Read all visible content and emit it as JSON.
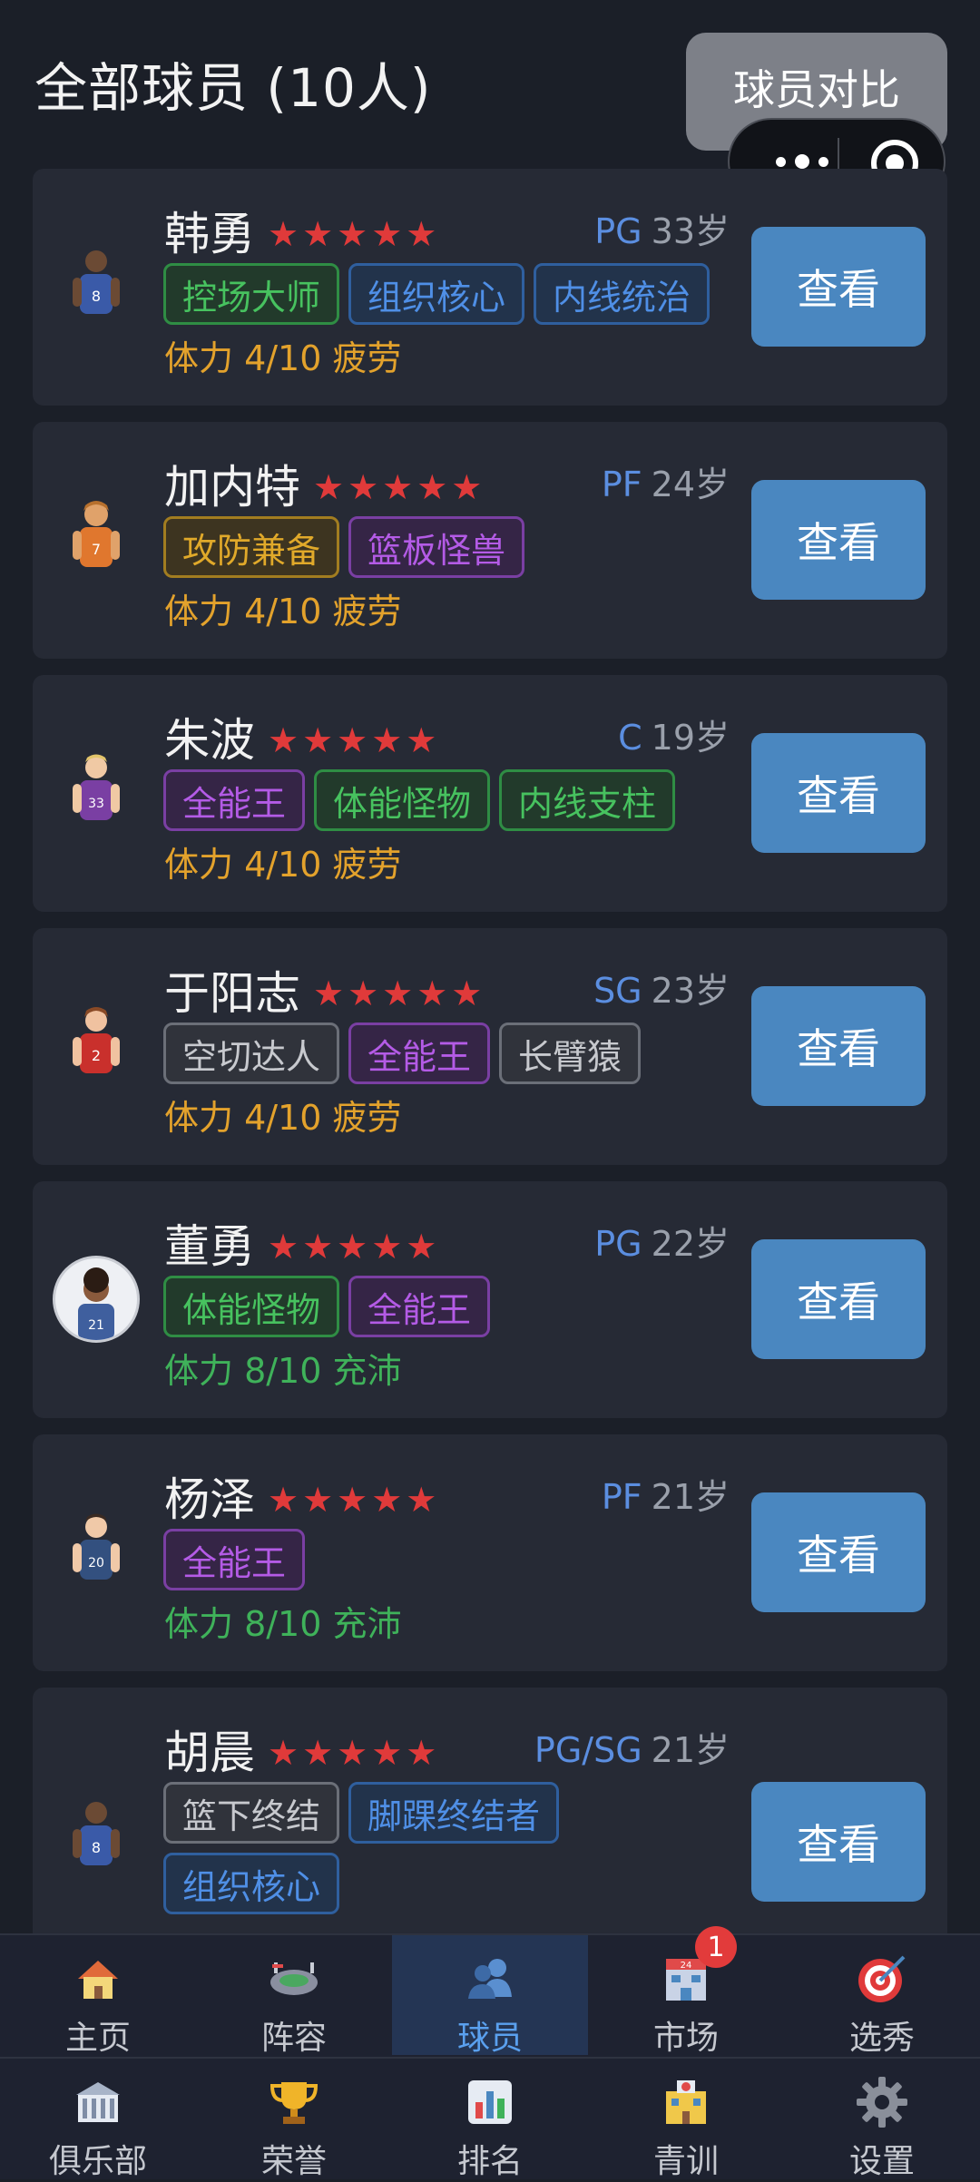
{
  "header": {
    "title": "全部球员 (10人)",
    "compare_label": "球员对比"
  },
  "players": [
    {
      "name": "韩勇",
      "stars": "★★★★★",
      "position": "PG",
      "age": "33岁",
      "tags": [
        {
          "label": "控场大师",
          "color": "green"
        },
        {
          "label": "组织核心",
          "color": "blue"
        },
        {
          "label": "内线统治",
          "color": "blue"
        }
      ],
      "stamina": "体力 4/10 疲劳",
      "view_label": "查看"
    },
    {
      "name": "加内特",
      "stars": "★★★★★",
      "position": "PF",
      "age": "24岁",
      "tags": [
        {
          "label": "攻防兼备",
          "color": "gold"
        },
        {
          "label": "篮板怪兽",
          "color": "purple"
        }
      ],
      "stamina": "体力 4/10 疲劳",
      "view_label": "查看"
    },
    {
      "name": "朱波",
      "stars": "★★★★★",
      "position": "C",
      "age": "19岁",
      "tags": [
        {
          "label": "全能王",
          "color": "purple"
        },
        {
          "label": "体能怪物",
          "color": "green"
        },
        {
          "label": "内线支柱",
          "color": "green"
        }
      ],
      "stamina": "体力 4/10 疲劳",
      "view_label": "查看"
    },
    {
      "name": "于阳志",
      "stars": "★★★★★",
      "position": "SG",
      "age": "23岁",
      "tags": [
        {
          "label": "空切达人",
          "color": "gray"
        },
        {
          "label": "全能王",
          "color": "purple"
        },
        {
          "label": "长臂猿",
          "color": "gray"
        }
      ],
      "stamina": "体力 4/10 疲劳",
      "view_label": "查看"
    },
    {
      "name": "董勇",
      "stars": "★★★★★",
      "position": "PG",
      "age": "22岁",
      "tags": [
        {
          "label": "体能怪物",
          "color": "green"
        },
        {
          "label": "全能王",
          "color": "purple"
        }
      ],
      "stamina": "体力 8/10 充沛",
      "view_label": "查看"
    },
    {
      "name": "杨泽",
      "stars": "★★★★★",
      "position": "PF",
      "age": "21岁",
      "tags": [
        {
          "label": "全能王",
          "color": "purple"
        }
      ],
      "stamina": "体力 8/10 充沛",
      "view_label": "查看"
    },
    {
      "name": "胡晨",
      "stars": "★★★★★",
      "position": "PG/SG",
      "age": "21岁",
      "tags": [
        {
          "label": "篮下终结",
          "color": "gray"
        },
        {
          "label": "脚踝终结者",
          "color": "blue"
        },
        {
          "label": "组织核心",
          "color": "blue"
        }
      ],
      "stamina": "",
      "view_label": "查看"
    }
  ],
  "tabs_row1": [
    {
      "label": "主页",
      "icon": "home-icon"
    },
    {
      "label": "阵容",
      "icon": "stadium-icon"
    },
    {
      "label": "球员",
      "icon": "players-icon",
      "active": true
    },
    {
      "label": "市场",
      "icon": "market-icon",
      "badge": "1"
    },
    {
      "label": "选秀",
      "icon": "draft-target-icon"
    }
  ],
  "tabs_row2": [
    {
      "label": "俱乐部",
      "icon": "club-building-icon"
    },
    {
      "label": "荣誉",
      "icon": "trophy-icon"
    },
    {
      "label": "排名",
      "icon": "ranking-chart-icon"
    },
    {
      "label": "青训",
      "icon": "youth-academy-icon"
    },
    {
      "label": "设置",
      "icon": "gear-icon"
    }
  ]
}
